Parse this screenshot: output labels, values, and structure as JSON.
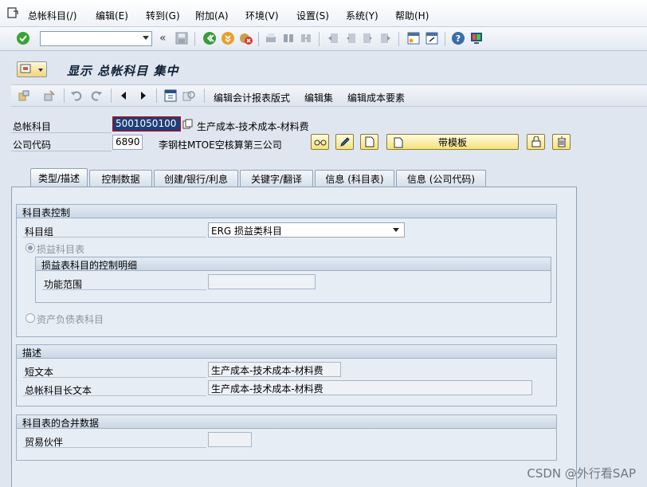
{
  "menu": {
    "items": [
      "总帐科目(/)",
      "编辑(E)",
      "转到(G)",
      "附加(A)",
      "环境(V)",
      "设置(S)",
      "系统(Y)",
      "帮助(H)"
    ]
  },
  "toolbar": {
    "command_value": "",
    "nav_back": "«"
  },
  "title": {
    "text": "显示 总帐科目 集中"
  },
  "app_toolbar": {
    "links": [
      "编辑会计报表版式",
      "编辑集",
      "编辑成本要素"
    ]
  },
  "header": {
    "gl_account_label": "总帐科目",
    "gl_account_value": "5001050100",
    "gl_account_desc": "生产成本-技术成本-材料费",
    "company_code_label": "公司代码",
    "company_code_value": "6890",
    "company_code_desc": "李钢柱MTOE空核算第三公司",
    "template_button": "带模板"
  },
  "tabs": [
    "类型/描述",
    "控制数据",
    "创建/银行/利息",
    "关键字/翻译",
    "信息 (科目表)",
    "信息 (公司代码)"
  ],
  "group_coa": {
    "title": "科目表控制",
    "account_group_label": "科目组",
    "account_group_value": "ERG 损益类科目",
    "pl_radio_label": "损益科目表",
    "pl_sub_title": "损益表科目的控制明细",
    "functional_area_label": "功能范围",
    "functional_area_value": "",
    "bs_radio_label": "资产负债表科目"
  },
  "group_desc": {
    "title": "描述",
    "short_text_label": "短文本",
    "short_text_value": "生产成本-技术成本-材料费",
    "long_text_label": "总帐科目长文本",
    "long_text_value": "生产成本-技术成本-材料费"
  },
  "group_consol": {
    "title": "科目表的合并数据",
    "partner_label": "贸易伙伴",
    "partner_value": ""
  },
  "watermark": "CSDN @外行看SAP",
  "colors": {
    "background": "#dfe6ef",
    "focus_field": "#1e3f79",
    "button_yellow": "#f5e27a"
  }
}
